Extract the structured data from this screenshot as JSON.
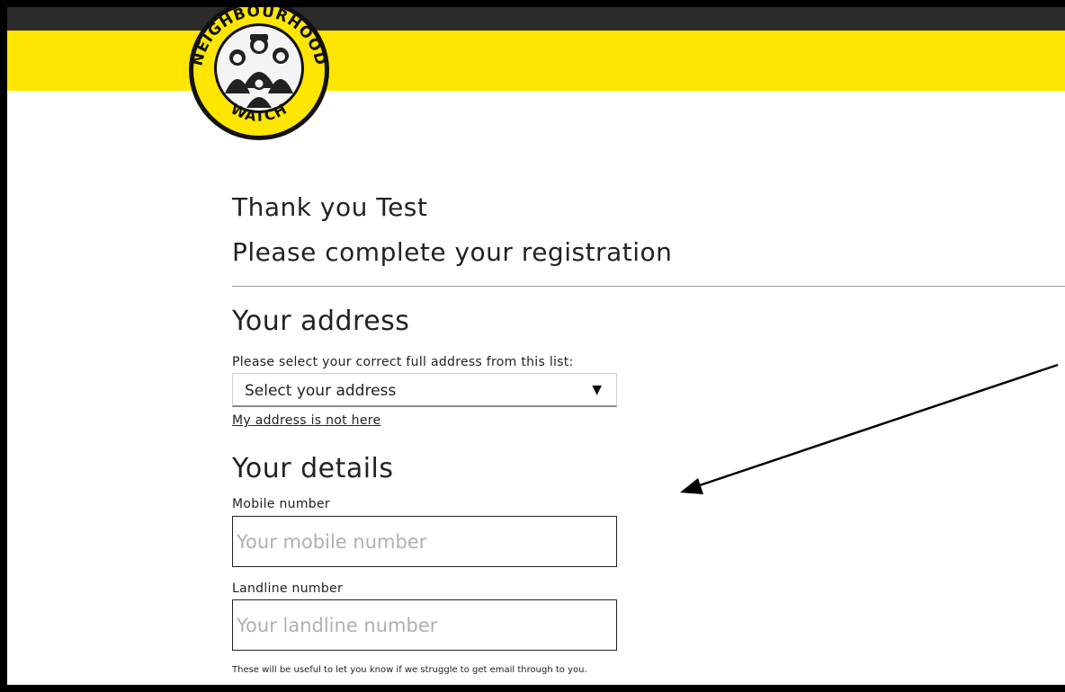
{
  "header": {
    "logo": {
      "icon": "neighbourhood-watch-logo",
      "text_top": "NEIGHBOURHOOD",
      "text_bottom": "WATCH"
    },
    "colors": {
      "topbar": "#2b2b2b",
      "accent": "#ffe600"
    }
  },
  "greeting": {
    "thank_you": "Thank you Test",
    "subtitle": "Please complete your registration"
  },
  "address": {
    "title": "Your address",
    "label": "Please select your correct full address from this list:",
    "select_value": "Select your address",
    "not_here_link": "My address is not here"
  },
  "details": {
    "title": "Your details",
    "mobile_label": "Mobile number",
    "mobile_placeholder": "Your mobile number",
    "landline_label": "Landline number",
    "landline_placeholder": "Your landline number",
    "note": "These will be useful to let you know if we struggle to get email through to you."
  }
}
